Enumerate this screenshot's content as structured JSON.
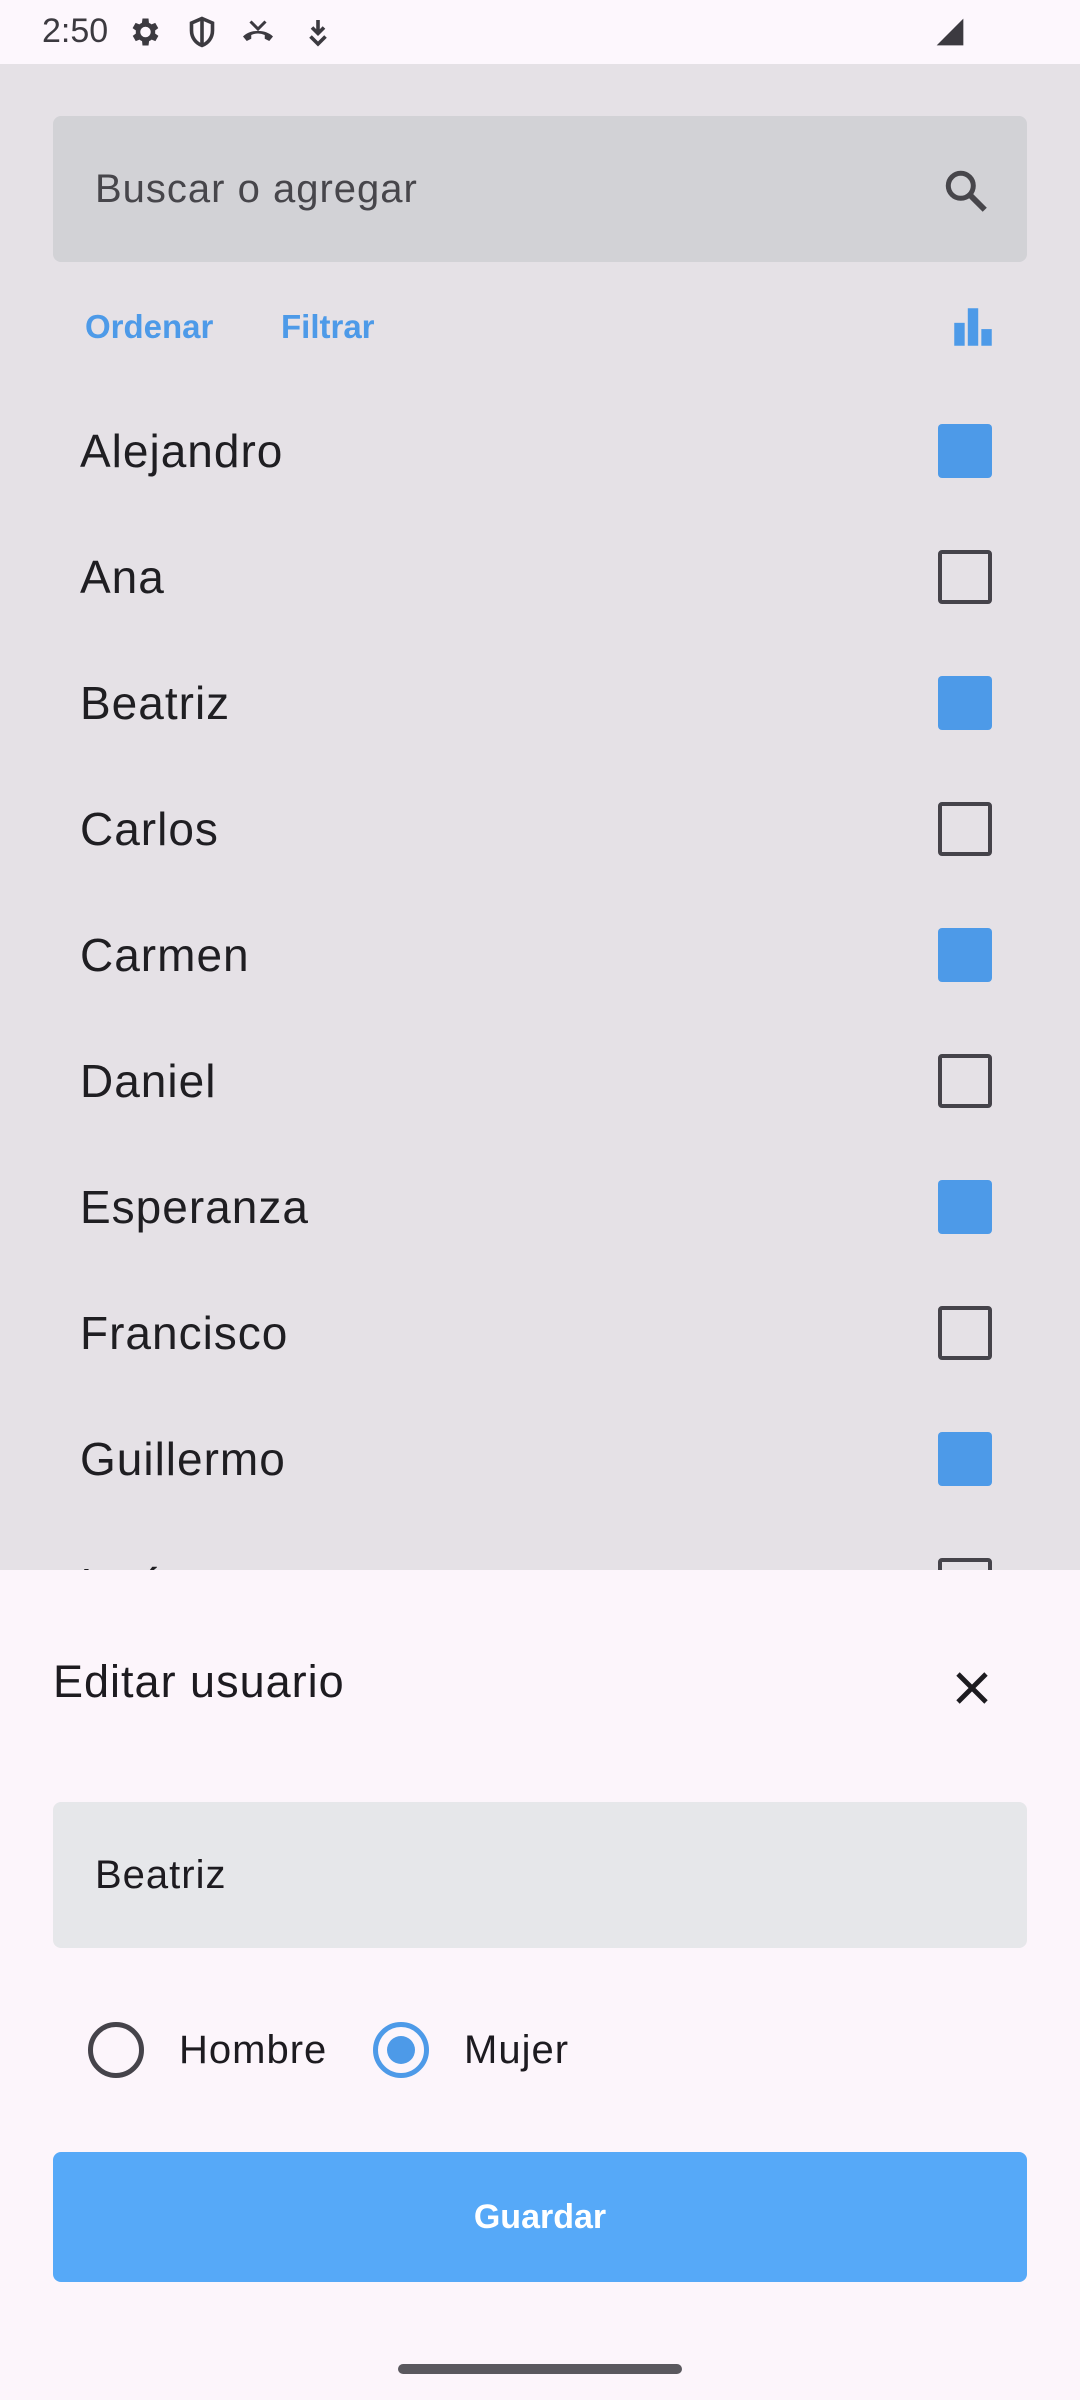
{
  "status_bar": {
    "time": "2:50",
    "icons": [
      "gear-icon",
      "shield-icon",
      "missed-call-icon",
      "download-icon",
      "signal-icon"
    ]
  },
  "search": {
    "placeholder": "Buscar o agregar",
    "icon": "search-icon"
  },
  "toolbar": {
    "sort_label": "Ordenar",
    "filter_label": "Filtrar",
    "stats_icon": "bar-chart-icon"
  },
  "list": {
    "items": [
      {
        "label": "Alejandro",
        "checked": true
      },
      {
        "label": "Ana",
        "checked": false
      },
      {
        "label": "Beatriz",
        "checked": true
      },
      {
        "label": "Carlos",
        "checked": false
      },
      {
        "label": "Carmen",
        "checked": true
      },
      {
        "label": "Daniel",
        "checked": false
      },
      {
        "label": "Esperanza",
        "checked": true
      },
      {
        "label": "Francisco",
        "checked": false
      },
      {
        "label": "Guillermo",
        "checked": true
      },
      {
        "label": "Isaías",
        "checked": false
      }
    ]
  },
  "sheet": {
    "title": "Editar usuario",
    "name_value": "Beatriz",
    "gender_options": [
      {
        "label": "Hombre",
        "selected": false
      },
      {
        "label": "Mujer",
        "selected": true
      }
    ],
    "save_label": "Guardar"
  },
  "colors": {
    "accent": "#4d9ae8",
    "button": "#56a9f8",
    "scrim": "#e5e1e6",
    "sheet": "#fcf5fb"
  }
}
